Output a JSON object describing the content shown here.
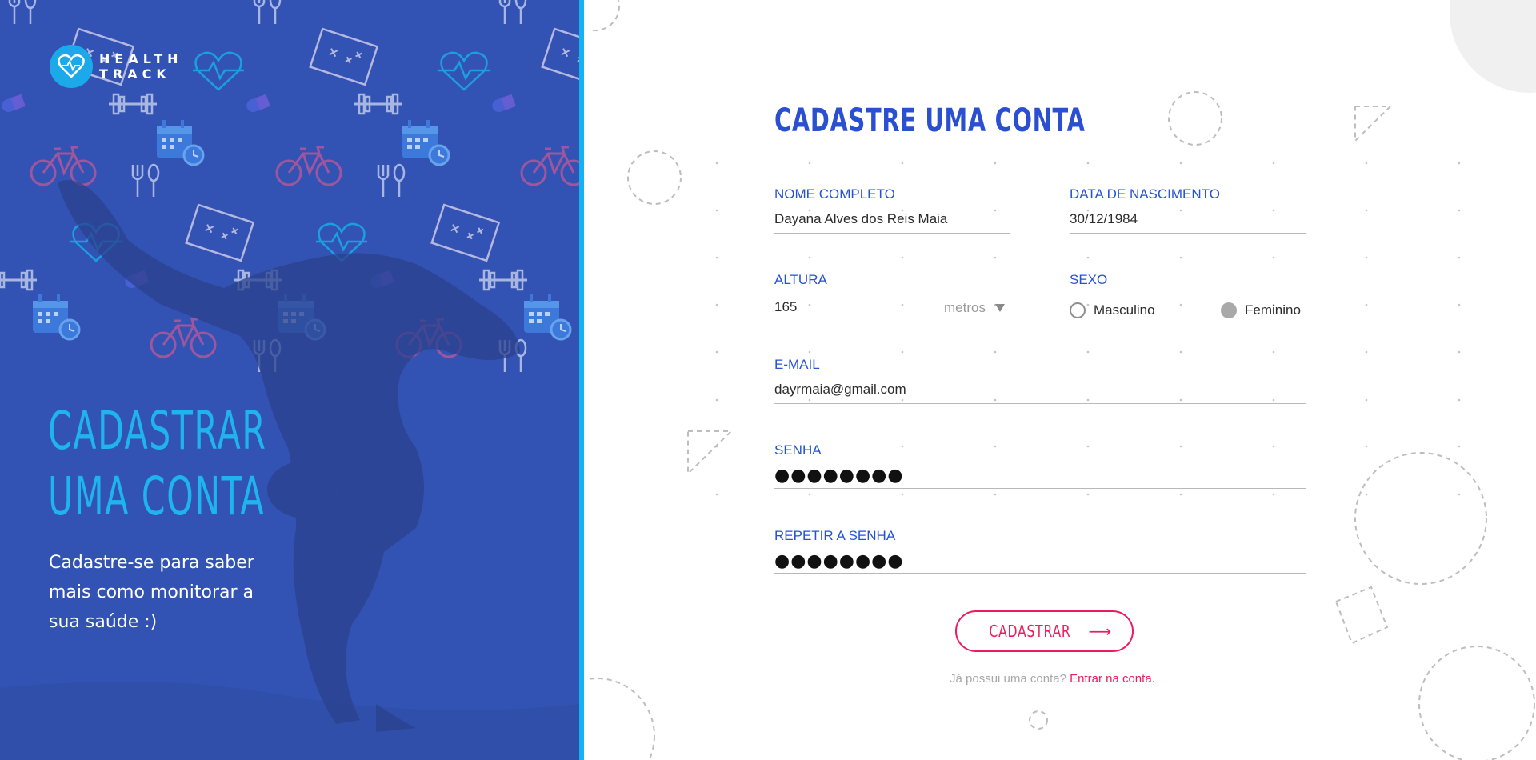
{
  "brand": {
    "line1": "HEALTH",
    "line2": "TRACK"
  },
  "hero": {
    "title_line1": "CADASTRAR",
    "title_line2": "UMA CONTA",
    "subtitle": "Cadastre-se para saber mais como monitorar a sua saúde :)"
  },
  "form": {
    "title": "CADASTRE UMA CONTA",
    "full_name": {
      "label": "NOME COMPLETO",
      "value": "Dayana Alves dos Reis Maia"
    },
    "birth_date": {
      "label": "DATA DE NASCIMENTO",
      "value": "30/12/1984"
    },
    "height": {
      "label": "ALTURA",
      "value": "165",
      "unit": "metros"
    },
    "sex": {
      "label": "SEXO",
      "options": [
        {
          "label": "Masculino",
          "selected": false
        },
        {
          "label": "Feminino",
          "selected": true
        }
      ]
    },
    "email": {
      "label": "E-MAIL",
      "value": "dayrmaia@gmail.com"
    },
    "password": {
      "label": "SENHA",
      "value": "●●●●●●●●"
    },
    "repeat_password": {
      "label": "REPETIR A SENHA",
      "value": "●●●●●●●●"
    },
    "submit_label": "CADASTRAR",
    "login_prompt": "Já possui uma conta?",
    "login_link": "Entrar na conta."
  },
  "colors": {
    "left_panel": "#3354b3",
    "accent_blue": "#1fb3ef",
    "label_blue": "#2652d8",
    "accent_pink": "#ec1c5e"
  },
  "icons": [
    "heart-pulse-icon",
    "arrow-right-icon",
    "caret-down-icon",
    "bicycle-icon",
    "dumbbell-icon",
    "calendar-clock-icon",
    "cutlery-icon",
    "clipboard-plan-icon",
    "capsule-icon"
  ]
}
